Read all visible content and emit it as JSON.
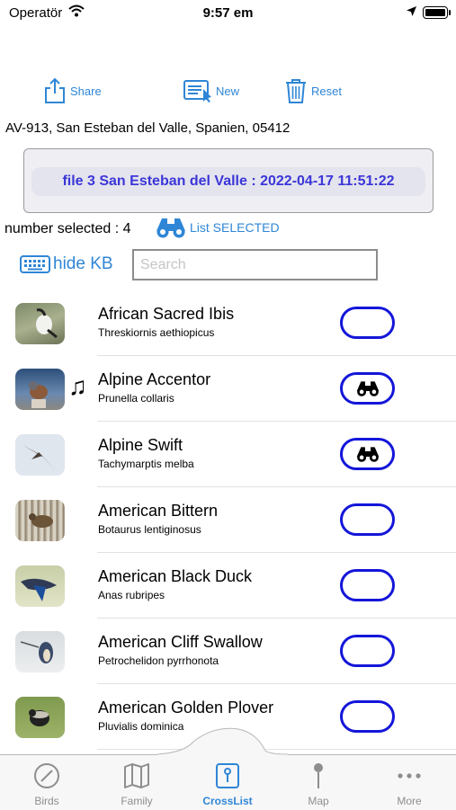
{
  "status": {
    "carrier": "Operatör",
    "time": "9:57 em"
  },
  "toolbar": {
    "share_label": "Share",
    "new_label": "New",
    "reset_label": "Reset"
  },
  "address": "AV-913, San Esteban del Valle, Spanien, 05412",
  "file_label": "file  3 San Esteban del Valle : 2022-04-17 11:51:22",
  "selection": {
    "count_text": "number selected : 4",
    "list_selected_label": "List SELECTED"
  },
  "keyboard": {
    "hide_label": "hide KB"
  },
  "search": {
    "placeholder": "Search",
    "value": ""
  },
  "birds": [
    {
      "common": "African Sacred Ibis",
      "scientific": "Threskiornis aethiopicus",
      "selected": false,
      "has_sound": false
    },
    {
      "common": "Alpine Accentor",
      "scientific": "Prunella collaris",
      "selected": true,
      "has_sound": true
    },
    {
      "common": "Alpine Swift",
      "scientific": "Tachymarptis melba",
      "selected": true,
      "has_sound": false
    },
    {
      "common": "American Bittern",
      "scientific": "Botaurus lentiginosus",
      "selected": false,
      "has_sound": false
    },
    {
      "common": "American Black Duck",
      "scientific": "Anas rubripes",
      "selected": false,
      "has_sound": false
    },
    {
      "common": "American Cliff Swallow",
      "scientific": "Petrochelidon pyrrhonota",
      "selected": false,
      "has_sound": false
    },
    {
      "common": "American Golden Plover",
      "scientific": "Pluvialis dominica",
      "selected": false,
      "has_sound": false
    }
  ],
  "tabs": [
    {
      "label": "Birds",
      "icon": "compass-icon"
    },
    {
      "label": "Family",
      "icon": "map-book-icon"
    },
    {
      "label": "CrossList",
      "icon": "crosslist-icon",
      "active": true
    },
    {
      "label": "Map",
      "icon": "map-pin-icon"
    },
    {
      "label": "More",
      "icon": "more-dots-icon"
    }
  ],
  "colors": {
    "accent": "#2f86d6",
    "toggle_border": "#1416d9",
    "file_text": "#3b36d8"
  }
}
